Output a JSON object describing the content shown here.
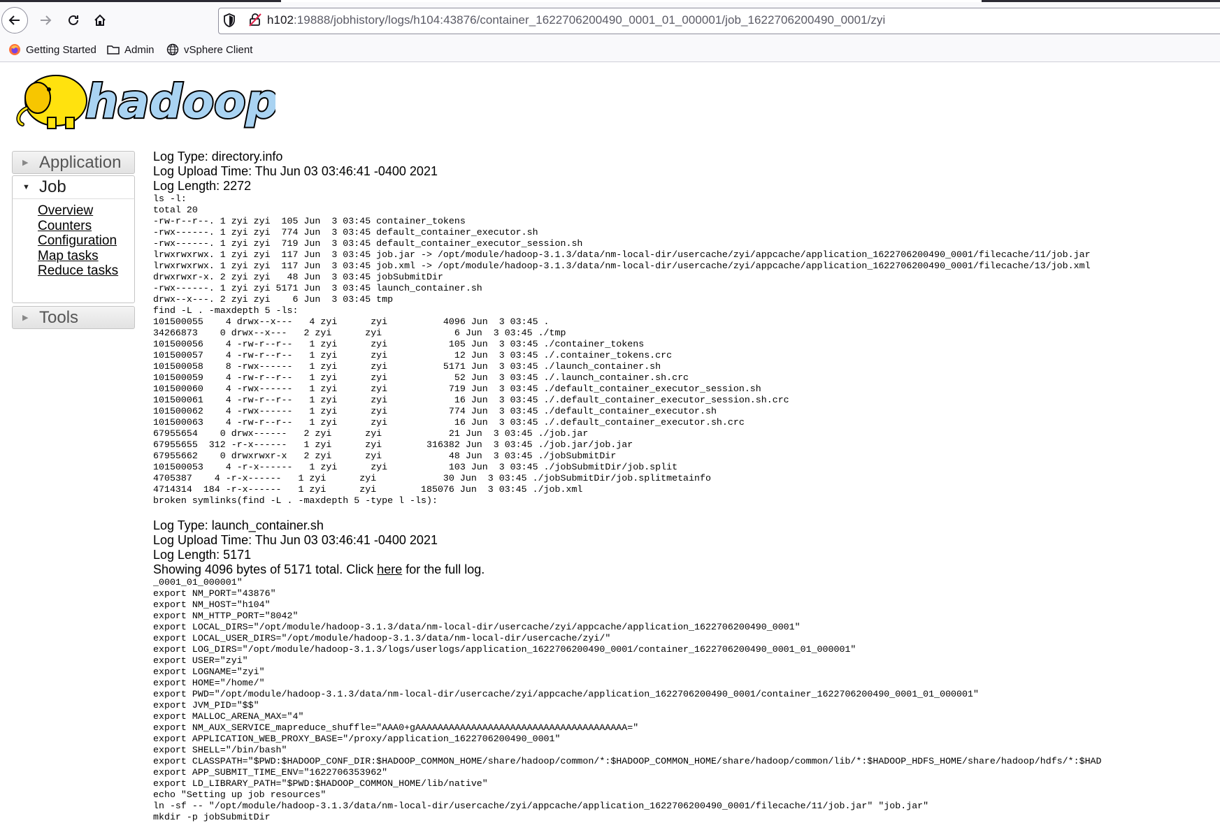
{
  "browser": {
    "url_host": "h102",
    "url_rest": ":19888/jobhistory/logs/h104:43876/container_1622706200490_0001_01_000001/job_1622706200490_0001/zyi",
    "bookmarks": [
      {
        "label": "Getting Started",
        "icon": "firefox-icon"
      },
      {
        "label": "Admin",
        "icon": "folder-icon"
      },
      {
        "label": "vSphere Client",
        "icon": "globe-icon"
      }
    ]
  },
  "logo": {
    "text": "hadoop"
  },
  "sidebar": {
    "application": "Application",
    "job": "Job",
    "job_links": [
      "Overview",
      "Counters",
      "Configuration",
      "Map tasks",
      "Reduce tasks"
    ],
    "tools": "Tools"
  },
  "logs": [
    {
      "type": "Log Type: directory.info",
      "upload": "Log Upload Time: Thu Jun 03 03:46:41 -0400 2021",
      "length": "Log Length: 2272",
      "body": "ls -l:\ntotal 20\n-rw-r--r--. 1 zyi zyi  105 Jun  3 03:45 container_tokens\n-rwx------. 1 zyi zyi  774 Jun  3 03:45 default_container_executor.sh\n-rwx------. 1 zyi zyi  719 Jun  3 03:45 default_container_executor_session.sh\nlrwxrwxrwx. 1 zyi zyi  117 Jun  3 03:45 job.jar -> /opt/module/hadoop-3.1.3/data/nm-local-dir/usercache/zyi/appcache/application_1622706200490_0001/filecache/11/job.jar\nlrwxrwxrwx. 1 zyi zyi  117 Jun  3 03:45 job.xml -> /opt/module/hadoop-3.1.3/data/nm-local-dir/usercache/zyi/appcache/application_1622706200490_0001/filecache/13/job.xml\ndrwxrwxr-x. 2 zyi zyi   48 Jun  3 03:45 jobSubmitDir\n-rwx------. 1 zyi zyi 5171 Jun  3 03:45 launch_container.sh\ndrwx--x---. 2 zyi zyi    6 Jun  3 03:45 tmp\nfind -L . -maxdepth 5 -ls:\n101500055    4 drwx--x---   4 zyi      zyi          4096 Jun  3 03:45 .\n34266873    0 drwx--x---   2 zyi      zyi             6 Jun  3 03:45 ./tmp\n101500056    4 -rw-r--r--   1 zyi      zyi           105 Jun  3 03:45 ./container_tokens\n101500057    4 -rw-r--r--   1 zyi      zyi            12 Jun  3 03:45 ./.container_tokens.crc\n101500058    8 -rwx------   1 zyi      zyi          5171 Jun  3 03:45 ./launch_container.sh\n101500059    4 -rw-r--r--   1 zyi      zyi            52 Jun  3 03:45 ./.launch_container.sh.crc\n101500060    4 -rwx------   1 zyi      zyi           719 Jun  3 03:45 ./default_container_executor_session.sh\n101500061    4 -rw-r--r--   1 zyi      zyi            16 Jun  3 03:45 ./.default_container_executor_session.sh.crc\n101500062    4 -rwx------   1 zyi      zyi           774 Jun  3 03:45 ./default_container_executor.sh\n101500063    4 -rw-r--r--   1 zyi      zyi            16 Jun  3 03:45 ./.default_container_executor.sh.crc\n67955654    0 drwx------   2 zyi      zyi            21 Jun  3 03:45 ./job.jar\n67955655  312 -r-x------   1 zyi      zyi        316382 Jun  3 03:45 ./job.jar/job.jar\n67955662    0 drwxrwxr-x   2 zyi      zyi            48 Jun  3 03:45 ./jobSubmitDir\n101500053    4 -r-x------   1 zyi      zyi           103 Jun  3 03:45 ./jobSubmitDir/job.split\n4705387    4 -r-x------   1 zyi      zyi            30 Jun  3 03:45 ./jobSubmitDir/job.splitmetainfo\n4714314  184 -r-x------   1 zyi      zyi        185076 Jun  3 03:45 ./job.xml\nbroken symlinks(find -L . -maxdepth 5 -type l -ls):"
    },
    {
      "type": "Log Type: launch_container.sh",
      "upload": "Log Upload Time: Thu Jun 03 03:46:41 -0400 2021",
      "length": "Log Length: 5171",
      "showing_pre": "Showing 4096 bytes of 5171 total. Click ",
      "showing_link": "here",
      "showing_post": " for the full log.",
      "body": "_0001_01_000001\"\nexport NM_PORT=\"43876\"\nexport NM_HOST=\"h104\"\nexport NM_HTTP_PORT=\"8042\"\nexport LOCAL_DIRS=\"/opt/module/hadoop-3.1.3/data/nm-local-dir/usercache/zyi/appcache/application_1622706200490_0001\"\nexport LOCAL_USER_DIRS=\"/opt/module/hadoop-3.1.3/data/nm-local-dir/usercache/zyi/\"\nexport LOG_DIRS=\"/opt/module/hadoop-3.1.3/logs/userlogs/application_1622706200490_0001/container_1622706200490_0001_01_000001\"\nexport USER=\"zyi\"\nexport LOGNAME=\"zyi\"\nexport HOME=\"/home/\"\nexport PWD=\"/opt/module/hadoop-3.1.3/data/nm-local-dir/usercache/zyi/appcache/application_1622706200490_0001/container_1622706200490_0001_01_000001\"\nexport JVM_PID=\"$$\"\nexport MALLOC_ARENA_MAX=\"4\"\nexport NM_AUX_SERVICE_mapreduce_shuffle=\"AAA0+gAAAAAAAAAAAAAAAAAAAAAAAAAAAAAAAAAAAAAA=\"\nexport APPLICATION_WEB_PROXY_BASE=\"/proxy/application_1622706200490_0001\"\nexport SHELL=\"/bin/bash\"\nexport CLASSPATH=\"$PWD:$HADOOP_CONF_DIR:$HADOOP_COMMON_HOME/share/hadoop/common/*:$HADOOP_COMMON_HOME/share/hadoop/common/lib/*:$HADOOP_HDFS_HOME/share/hadoop/hdfs/*:$HAD\nexport APP_SUBMIT_TIME_ENV=\"1622706353962\"\nexport LD_LIBRARY_PATH=\"$PWD:$HADOOP_COMMON_HOME/lib/native\"\necho \"Setting up job resources\"\nln -sf -- \"/opt/module/hadoop-3.1.3/data/nm-local-dir/usercache/zyi/appcache/application_1622706200490_0001/filecache/11/job.jar\" \"job.jar\"\nmkdir -p jobSubmitDir"
    }
  ]
}
